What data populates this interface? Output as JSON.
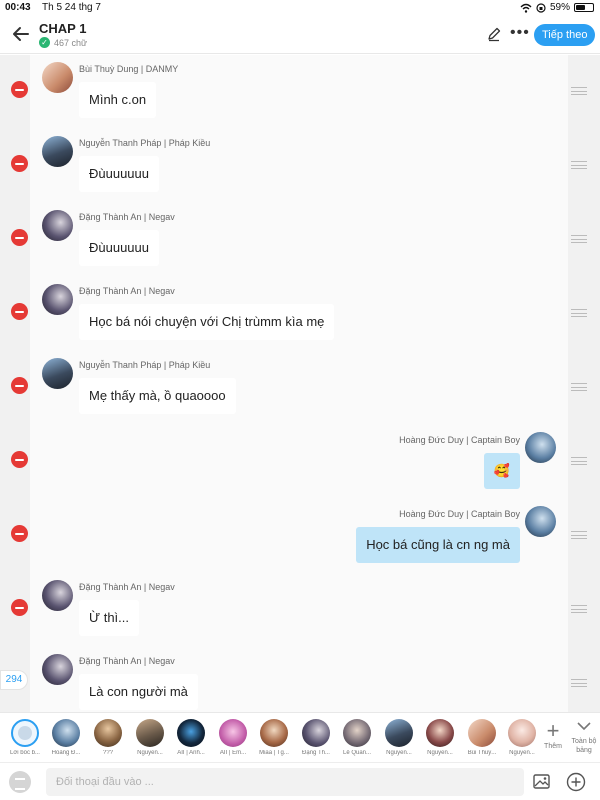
{
  "status": {
    "time": "00:43",
    "date": "Th 5 24 thg 7",
    "battery": "59%",
    "battery_level": 0.59
  },
  "header": {
    "title": "CHAP 1",
    "word_count": "467 chữ",
    "follow_label": "Tiếp theo"
  },
  "messages": [
    {
      "speaker": "Bùi Thuỳ Dung | DANMY",
      "text": "Mình c.on",
      "side": "left"
    },
    {
      "speaker": "Nguyễn Thanh Pháp | Pháp Kiều",
      "text": "Đùuuuuuu",
      "side": "left"
    },
    {
      "speaker": "Đặng Thành An | Negav",
      "text": "Đùuuuuuu",
      "side": "left"
    },
    {
      "speaker": "Đặng Thành An | Negav",
      "text": "Học bá nói chuyện với Chị trùmm kìa mẹ",
      "side": "left"
    },
    {
      "speaker": "Nguyễn Thanh Pháp | Pháp Kiều",
      "text": "Mẹ thấy mà, ồ quaoooo",
      "side": "left"
    },
    {
      "speaker": "Hoàng Đức Duy | Captain Boy",
      "text": "🥰",
      "side": "right"
    },
    {
      "speaker": "Hoàng Đức Duy | Captain Boy",
      "text": "Học bá cũng là cn ng mà",
      "side": "right"
    },
    {
      "speaker": "Đặng Thành An | Negav",
      "text": "Ừ thì...",
      "side": "left"
    },
    {
      "speaker": "Đặng Thành An | Negav",
      "text": "Là con người mà",
      "side": "left"
    }
  ],
  "message_count": "294",
  "characters": [
    {
      "label": "Lời bốc b..."
    },
    {
      "label": "Hoàng Đ..."
    },
    {
      "label": "???"
    },
    {
      "label": "Nguyễn..."
    },
    {
      "label": "AII | Anh..."
    },
    {
      "label": "AII | Em..."
    },
    {
      "label": "Miaa | Tg..."
    },
    {
      "label": "Đặng Th..."
    },
    {
      "label": "Lê Quan..."
    },
    {
      "label": "Nguyễn..."
    },
    {
      "label": "Nguyễn..."
    },
    {
      "label": "Bùi Thuỳ..."
    },
    {
      "label": "Nguyễn..."
    }
  ],
  "add_label": "Thêm",
  "all_label": "Toàn bộ bảng",
  "input": {
    "placeholder": "Đối thoại đầu vào ..."
  },
  "colors": {
    "accent": "#2b9ff2",
    "delete": "#e53935",
    "my_bubble": "#bfe4f8",
    "check": "#2bb673"
  }
}
